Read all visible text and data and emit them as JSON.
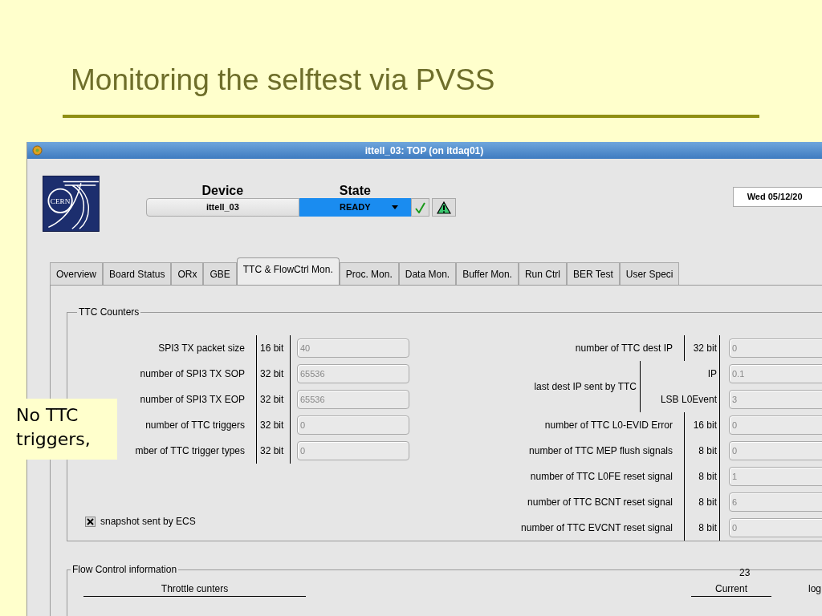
{
  "slide": {
    "title": "Monitoring the selftest via PVSS",
    "callout": "No TTC triggers,",
    "page_number": "23"
  },
  "window": {
    "title": "ittell_03: TOP (on itdaq01)"
  },
  "header": {
    "logo_text": "CERN",
    "device_label": "Device",
    "device": "ittell_03",
    "state_label": "State",
    "state": "READY",
    "date": "Wed 05/12/20"
  },
  "tabs": [
    {
      "label": "Overview",
      "selected": false
    },
    {
      "label": "Board Status",
      "selected": false
    },
    {
      "label": "ORx",
      "selected": false
    },
    {
      "label": "GBE",
      "selected": false
    },
    {
      "label": "TTC & FlowCtrl Mon.",
      "selected": true
    },
    {
      "label": "Proc. Mon.",
      "selected": false
    },
    {
      "label": "Data Mon.",
      "selected": false
    },
    {
      "label": "Buffer Mon.",
      "selected": false
    },
    {
      "label": "Run Ctrl",
      "selected": false
    },
    {
      "label": "BER Test",
      "selected": false
    },
    {
      "label": "User Speci",
      "selected": false
    }
  ],
  "ttc_counters": {
    "title": "TTC Counters",
    "left_rows": [
      {
        "label": "SPI3 TX packet size",
        "bits": "16 bit",
        "value": "40"
      },
      {
        "label": "number of SPI3 TX SOP",
        "bits": "32 bit",
        "value": "65536"
      },
      {
        "label": "number of SPI3 TX EOP",
        "bits": "32 bit",
        "value": "65536"
      },
      {
        "label": "number of TTC triggers",
        "bits": "32 bit",
        "value": "0"
      },
      {
        "label": "mber of TTC trigger types",
        "bits": "32 bit",
        "value": "0"
      }
    ],
    "snapshot": {
      "label": "snapshot sent by ECS",
      "checked": true
    },
    "right_rows": [
      {
        "kind": "single",
        "label": "number of TTC dest IP",
        "bits": "32 bit",
        "value": "0"
      },
      {
        "kind": "group",
        "label": "last dest IP sent by TTC",
        "parts": [
          {
            "label": "IP",
            "value": "0.1"
          },
          {
            "label": "LSB L0Event",
            "value": "3"
          }
        ]
      },
      {
        "kind": "single",
        "label": "number of TTC L0-EVID Error",
        "bits": "16 bit",
        "value": "0"
      },
      {
        "kind": "single",
        "label": "number of TTC MEP flush signals",
        "bits": "8 bit",
        "value": "0"
      },
      {
        "kind": "single",
        "label": "number of TTC L0FE reset signal",
        "bits": "8 bit",
        "value": "1"
      },
      {
        "kind": "single",
        "label": "number of TTC BCNT reset signal",
        "bits": "8 bit",
        "value": "6"
      },
      {
        "kind": "single",
        "label": "number of TTC EVCNT reset signal",
        "bits": "8 bit",
        "value": "0"
      }
    ]
  },
  "flow_control": {
    "title": "Flow Control information",
    "throttle_heading": "Throttle cunters",
    "current_heading": "Current",
    "column_3": "log"
  }
}
